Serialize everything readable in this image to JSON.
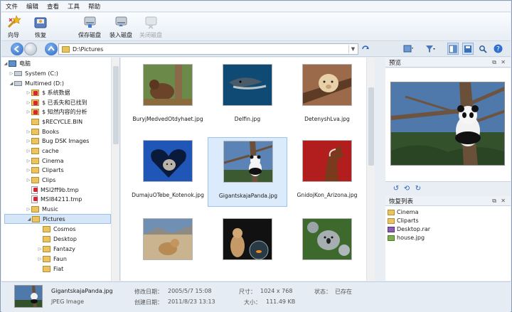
{
  "menu": [
    "文件",
    "编辑",
    "查看",
    "工具",
    "帮助"
  ],
  "toolbar": {
    "wizard": "向导",
    "recover": "恢复",
    "save_disk": "保存磁盘",
    "load_disk": "装入磁盘",
    "close_disk": "关闭磁盘"
  },
  "address": {
    "path": "D:\\Pictures"
  },
  "tree": [
    {
      "label": "电脑",
      "kind": "pc"
    },
    {
      "label": "System (C:)",
      "kind": "drive"
    },
    {
      "label": "Multimed (D:)",
      "kind": "drive"
    },
    {
      "label": "$ 系统数据",
      "kind": "folder-red"
    },
    {
      "label": "$ 已丢失和已找到",
      "kind": "folder-red"
    },
    {
      "label": "$ 知然内容的分析",
      "kind": "folder-red"
    },
    {
      "label": "$RECYCLE.BIN",
      "kind": "folder"
    },
    {
      "label": "Books",
      "kind": "folder"
    },
    {
      "label": "Bug DSK Images",
      "kind": "folder"
    },
    {
      "label": "cache",
      "kind": "folder"
    },
    {
      "label": "Cinema",
      "kind": "folder"
    },
    {
      "label": "Cliparts",
      "kind": "folder"
    },
    {
      "label": "Clips",
      "kind": "folder"
    },
    {
      "label": "MSI2ff9b.tmp",
      "kind": "file-red"
    },
    {
      "label": "MSI84211.tmp",
      "kind": "file-red"
    },
    {
      "label": "Music",
      "kind": "folder"
    },
    {
      "label": "Pictures",
      "kind": "folder"
    },
    {
      "label": "Cosmos",
      "kind": "folder"
    },
    {
      "label": "Desktop",
      "kind": "folder"
    },
    {
      "label": "Fantazy",
      "kind": "folder"
    },
    {
      "label": "Faun",
      "kind": "folder"
    },
    {
      "label": "Fiat",
      "kind": "folder"
    }
  ],
  "files": [
    {
      "name": "BuryjMedvedOtdyhaet.jpg"
    },
    {
      "name": "Delfin.jpg"
    },
    {
      "name": "DetenyshLva.jpg"
    },
    {
      "name": "DumajuOTebe_Kotenok.jpg"
    },
    {
      "name": "GigantskajaPanda.jpg"
    },
    {
      "name": "GnidojKon_Arizona.jpg"
    },
    {
      "name": ""
    },
    {
      "name": ""
    },
    {
      "name": ""
    }
  ],
  "preview": {
    "title": "预览"
  },
  "recovery_list": {
    "title": "恢复列表",
    "items": [
      "Cinema",
      "Cliparts",
      "Desktop.rar",
      "house.jpg"
    ]
  },
  "status": {
    "filename": "GigantskajaPanda.jpg",
    "filetype": "JPEG Image",
    "modified_label": "修改日期：",
    "modified": "2005/5/7 15:08",
    "created_label": "创建日期：",
    "created": "2011/8/23 13:13",
    "dimensions_label": "尺寸：",
    "dimensions": "1024 x 768",
    "size_label": "大小：",
    "size": "111.49 KB",
    "state_label": "状态：",
    "state": "已存在"
  }
}
